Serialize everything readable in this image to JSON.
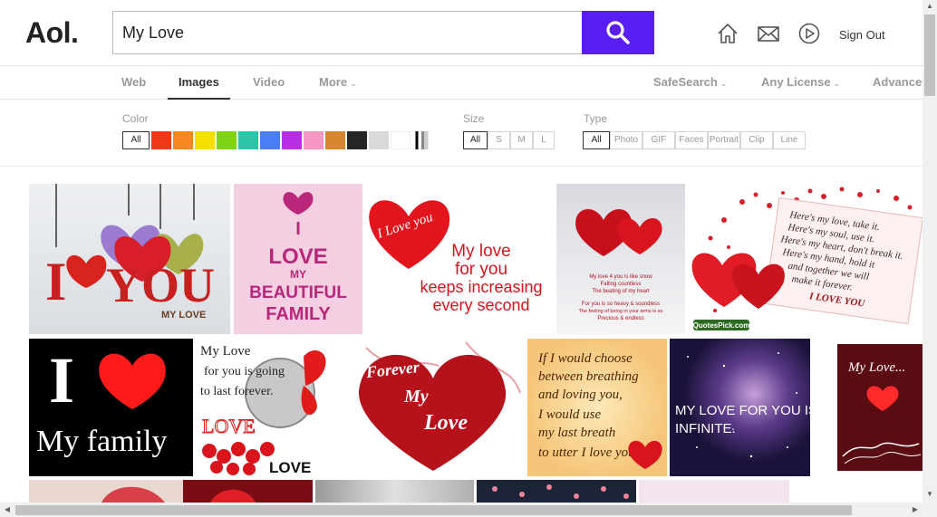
{
  "header": {
    "logo": "Aol.",
    "search_value": "My Love",
    "signout_label": "Sign Out",
    "brand_color": "#5a1ef5"
  },
  "tabs": [
    {
      "label": "Web",
      "active": false
    },
    {
      "label": "Images",
      "active": true
    },
    {
      "label": "Video",
      "active": false
    },
    {
      "label": "More",
      "active": false,
      "has_dropdown": true
    },
    {
      "label": "SafeSearch",
      "active": false,
      "has_dropdown": true
    },
    {
      "label": "Any License",
      "active": false,
      "has_dropdown": true
    },
    {
      "label": "Advanced",
      "active": false
    }
  ],
  "filters": {
    "color": {
      "label": "Color",
      "all_label": "All",
      "swatches": [
        "#f03a17",
        "#f7871e",
        "#f4e000",
        "#7dd415",
        "#2ec4a9",
        "#4a7ef7",
        "#b92ee4",
        "#f798c4",
        "#d98632",
        "#262626",
        "#d9d9d9",
        "#ffffff",
        "black-white"
      ]
    },
    "size": {
      "label": "Size",
      "options": [
        {
          "label": "All",
          "selected": true
        },
        {
          "label": "S",
          "selected": false
        },
        {
          "label": "M",
          "selected": false
        },
        {
          "label": "L",
          "selected": false
        }
      ]
    },
    "type": {
      "label": "Type",
      "options": [
        {
          "label": "All",
          "selected": true
        },
        {
          "label": "Photo",
          "selected": false
        },
        {
          "label": "GIF",
          "selected": false
        },
        {
          "label": "Faces",
          "selected": false
        },
        {
          "label": "Portrait",
          "selected": false
        },
        {
          "label": "Clip",
          "selected": false
        },
        {
          "label": "Line",
          "selected": false
        }
      ]
    }
  },
  "images": {
    "r1_1": {
      "big": "YOU",
      "small": "MY LOVE",
      "letter": "I"
    },
    "r1_2": {
      "line1": "I",
      "line2": "LOVE",
      "line3": "MY",
      "line4": "BEAUTIFUL",
      "line5": "FAMILY"
    },
    "r1_3": {
      "heart_text": "I Love you",
      "line1": "My love",
      "line2": "for you",
      "line3": "keeps increasing",
      "line4": "every second"
    },
    "r1_4": {
      "line1": "My love 4 you is like snow",
      "line2": "Falling countless",
      "line3": "The beating of my heart",
      "line4": "For you is so heavy & soundless",
      "line5": "The feeling of being in your arms is so",
      "line6": "Precious & endless"
    },
    "r1_5": {
      "line1": "Here's my love, take it.",
      "line2": "Here's my soul, use it.",
      "line3": "Here's my heart, don't break it.",
      "line4": "Here's my hand, hold it",
      "line5": "and together we will",
      "line6": "make it forever.",
      "line7": "I LOVE YOU",
      "badge": "QuotesPick.com"
    },
    "r2_1": {
      "letter": "I",
      "line": "My family"
    },
    "r2_2": {
      "line1": "My Love",
      "line2": "for you is going",
      "line3": "to last forever.",
      "love": "LOVE",
      "bottom": "LOVE"
    },
    "r2_3": {
      "line1": "Forever",
      "line2": "My",
      "line3": "Love"
    },
    "r2_4": {
      "line1": "If I would choose",
      "line2": "between breathing",
      "line3": "and loving you,",
      "line4": "I would use",
      "line5": "my last breath",
      "line6": "to utter I love you"
    },
    "r2_5": {
      "line1": "MY LOVE FOR YOU IS",
      "line2": "INFINITE."
    },
    "r2_6": {
      "line1": "My Love..."
    }
  }
}
